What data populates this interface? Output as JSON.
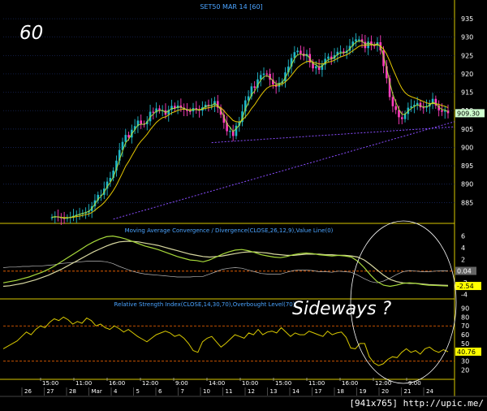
{
  "header": {
    "title": "SET50 MAR 14  [60]",
    "big_label": "60",
    "annotation": "Sideways ?",
    "footer_credit": "[941x765] http://upic.me/"
  },
  "colors": {
    "background": "#000000",
    "price_axis": "#ffffff",
    "title_text": "#4aa3ff",
    "up_candle": "#1fb8c8",
    "down_candle": "#ff3dbd",
    "ma_fast": "#a7d93a",
    "ma_slow": "#e6c800",
    "trendline": "#8a4dff",
    "macd_line": "#a7d93a",
    "macd_signal": "#d8d8a0",
    "macd_hist": "#b8b8b8",
    "rsi_line": "#d8c800",
    "overbought": "#ff6a00",
    "frame": "#d8c800",
    "circle": "#ffffff",
    "last_price_box": "#d0ffd0",
    "highlight_box": "#ffff00"
  },
  "chart_data": [
    {
      "type": "candlestick",
      "title": "SET50 MAR 14  [60]",
      "ylim": [
        880,
        937
      ],
      "yticks": [
        885,
        890,
        895,
        900,
        905,
        910,
        915,
        920,
        925,
        930,
        935
      ],
      "last_value_label": "909.30",
      "last_value": 909.3,
      "series_close": [
        881.0,
        881.2,
        881.0,
        880.8,
        880.6,
        880.9,
        881.1,
        881.4,
        881.7,
        881.9,
        882.2,
        882.3,
        882.7,
        884.0,
        885.6,
        887.1,
        887.1,
        888.8,
        890.7,
        891.7,
        893.7,
        896.4,
        899.3,
        901.5,
        903.4,
        902.7,
        904.8,
        905.8,
        907.3,
        906.4,
        906.3,
        907.1,
        909.7,
        909.5,
        910.6,
        910.1,
        910.1,
        908.9,
        910.2,
        911.3,
        910.7,
        911.4,
        910.8,
        910.4,
        909.9,
        909.8,
        910.7,
        910.3,
        910.0,
        910.9,
        911.6,
        911.4,
        911.5,
        912.6,
        910.8,
        908.9,
        906.7,
        904.4,
        904.5,
        903.1,
        905.9,
        906.9,
        909.8,
        912.8,
        913.9,
        916.6,
        916.2,
        918.5,
        919.7,
        920.1,
        920.0,
        918.4,
        917.1,
        916.5,
        917.5,
        917.9,
        920.4,
        922.0,
        924.3,
        925.9,
        926.3,
        925.5,
        924.8,
        925.4,
        923.1,
        921.5,
        922.1,
        921.1,
        922.5,
        924.1,
        924.7,
        924.1,
        925.1,
        926.0,
        926.1,
        925.7,
        926.3,
        927.6,
        928.8,
        929.4,
        929.4,
        928.7,
        927.0,
        928.8,
        927.8,
        927.7,
        928.6,
        926.4,
        922.1,
        918.8,
        913.7,
        911.2,
        910.2,
        908.2,
        907.7,
        909.1,
        910.8,
        911.2,
        911.6,
        912.1,
        910.9,
        910.8,
        911.1,
        911.8,
        913.2,
        911.4,
        910.1,
        909.7,
        910.0,
        909.3
      ],
      "series_ma_fast": [
        881.0,
        881.2,
        881.1,
        880.9,
        880.7,
        880.8,
        881.0,
        881.2,
        881.5,
        881.8,
        882.0,
        882.3,
        882.6,
        883.4,
        884.6,
        885.9,
        886.7,
        887.8,
        889.3,
        890.5,
        892.0,
        894.1,
        896.6,
        899.0,
        901.3,
        902.2,
        903.7,
        904.8,
        906.1,
        906.3,
        906.3,
        906.8,
        908.3,
        909.0,
        909.9,
        910.0,
        910.1,
        909.5,
        909.9,
        910.6,
        910.6,
        911.0,
        910.9,
        910.6,
        910.3,
        910.0,
        910.3,
        910.3,
        910.1,
        910.5,
        911.1,
        911.3,
        911.4,
        912.0,
        911.4,
        910.2,
        908.4,
        906.4,
        905.5,
        904.3,
        905.1,
        906.0,
        907.9,
        910.4,
        912.2,
        914.4,
        915.3,
        916.9,
        918.3,
        919.2,
        919.6,
        919.0,
        918.1,
        917.3,
        917.4,
        917.6,
        919.0,
        920.5,
        922.4,
        924.2,
        925.2,
        925.4,
        925.1,
        925.2,
        924.2,
        922.8,
        922.5,
        921.8,
        922.1,
        923.1,
        923.9,
        924.0,
        924.5,
        925.3,
        925.7,
        925.7,
        926.0,
        926.8,
        927.8,
        928.6,
        929.0,
        928.9,
        928.0,
        928.4,
        928.1,
        927.9,
        928.2,
        927.3,
        924.7,
        921.8,
        917.8,
        914.5,
        912.3,
        910.3,
        909.0,
        909.0,
        909.9,
        910.6,
        911.1,
        911.6,
        911.3,
        911.0,
        911.1,
        911.4,
        912.3,
        911.9,
        911.0,
        910.3,
        910.2,
        909.7
      ],
      "series_ma_slow": [
        881.0,
        881.1,
        881.1,
        881.0,
        880.9,
        880.9,
        880.9,
        881.0,
        881.2,
        881.3,
        881.5,
        881.7,
        881.9,
        882.3,
        882.9,
        883.6,
        884.2,
        885.0,
        886.0,
        887.1,
        888.3,
        889.7,
        891.4,
        893.1,
        894.9,
        896.2,
        897.7,
        899.1,
        900.6,
        901.7,
        902.6,
        903.6,
        904.8,
        905.8,
        906.8,
        907.5,
        908.1,
        908.3,
        908.8,
        909.4,
        909.7,
        910.1,
        910.3,
        910.4,
        910.3,
        910.2,
        910.3,
        910.3,
        910.3,
        910.4,
        910.6,
        910.8,
        910.9,
        911.3,
        911.2,
        910.8,
        910.0,
        909.0,
        908.2,
        907.3,
        907.0,
        906.9,
        907.4,
        908.3,
        909.3,
        910.6,
        911.6,
        912.9,
        914.1,
        915.2,
        916.1,
        916.6,
        916.8,
        916.8,
        917.0,
        917.2,
        917.8,
        918.6,
        919.6,
        920.7,
        921.7,
        922.4,
        922.9,
        923.4,
        923.4,
        923.2,
        923.0,
        922.7,
        922.7,
        922.9,
        923.2,
        923.4,
        923.7,
        924.2,
        924.6,
        924.9,
        925.2,
        925.7,
        926.3,
        926.9,
        927.5,
        927.8,
        927.7,
        927.9,
        927.9,
        927.8,
        927.9,
        927.6,
        926.7,
        925.4,
        923.5,
        921.4,
        919.5,
        917.6,
        916.0,
        914.9,
        914.2,
        913.8,
        913.5,
        913.2,
        912.8,
        912.5,
        912.1,
        911.9,
        912.0,
        911.9,
        911.7,
        911.4,
        911.2,
        910.8
      ]
    },
    {
      "type": "line",
      "title": "Moving Average Convergence / Divergence(CLOSE,26,12,9),Value Line(0)",
      "ylim": [
        -4.2,
        7.2
      ],
      "yticks": [
        -4,
        -2,
        0,
        2,
        4,
        6
      ],
      "value_line": 0,
      "last_value_labels": [
        "0.04",
        "-2.54"
      ],
      "series": [
        {
          "name": "MACD",
          "values": [
            -2.0,
            -1.8,
            -1.6,
            -1.3,
            -1.0,
            -0.6,
            -0.2,
            0.3,
            0.9,
            1.6,
            2.3,
            3.0,
            3.7,
            4.4,
            5.0,
            5.5,
            5.9,
            6.0,
            5.8,
            5.5,
            5.1,
            4.7,
            4.3,
            4.0,
            3.7,
            3.3,
            2.9,
            2.5,
            2.2,
            1.9,
            1.8,
            1.6,
            1.9,
            2.4,
            2.9,
            3.3,
            3.6,
            3.7,
            3.5,
            3.2,
            2.8,
            2.6,
            2.4,
            2.3,
            2.5,
            2.8,
            3.0,
            3.1,
            3.0,
            2.8,
            2.7,
            2.6,
            2.7,
            2.6,
            2.4,
            1.7,
            0.6,
            -0.7,
            -1.8,
            -2.4,
            -2.6,
            -2.4,
            -2.1,
            -2.0,
            -2.1,
            -2.3,
            -2.4,
            -2.45,
            -2.5,
            -2.54
          ]
        },
        {
          "name": "Signal",
          "values": [
            -2.6,
            -2.5,
            -2.3,
            -2.1,
            -1.8,
            -1.5,
            -1.1,
            -0.7,
            -0.2,
            0.3,
            0.9,
            1.5,
            2.1,
            2.7,
            3.3,
            3.8,
            4.3,
            4.7,
            5.0,
            5.1,
            5.1,
            5.0,
            4.8,
            4.6,
            4.4,
            4.1,
            3.8,
            3.5,
            3.2,
            2.9,
            2.7,
            2.5,
            2.4,
            2.5,
            2.6,
            2.8,
            3.0,
            3.2,
            3.3,
            3.3,
            3.2,
            3.1,
            2.9,
            2.8,
            2.7,
            2.7,
            2.8,
            2.9,
            2.9,
            2.9,
            2.8,
            2.8,
            2.7,
            2.7,
            2.6,
            2.4,
            1.9,
            1.1,
            0.2,
            -0.7,
            -1.4,
            -1.8,
            -2.0,
            -2.1,
            -2.1,
            -2.2,
            -2.3,
            -2.35,
            -2.4,
            -2.45
          ]
        },
        {
          "name": "Histogram",
          "values": [
            0.6,
            0.7,
            0.7,
            0.8,
            0.8,
            0.9,
            0.9,
            1.0,
            1.1,
            1.3,
            1.4,
            1.5,
            1.6,
            1.7,
            1.7,
            1.7,
            1.6,
            1.3,
            0.8,
            0.4,
            0.0,
            -0.3,
            -0.5,
            -0.6,
            -0.7,
            -0.8,
            -0.9,
            -1.0,
            -1.0,
            -1.0,
            -0.9,
            -0.9,
            -0.5,
            -0.1,
            0.3,
            0.5,
            0.6,
            0.5,
            0.2,
            -0.1,
            -0.4,
            -0.5,
            -0.5,
            -0.5,
            -0.2,
            0.1,
            0.2,
            0.2,
            0.1,
            -0.1,
            -0.1,
            -0.2,
            0.0,
            -0.1,
            -0.2,
            -0.7,
            -1.3,
            -1.8,
            -2.0,
            -1.7,
            -1.2,
            -0.6,
            -0.1,
            0.1,
            0.0,
            -0.1,
            -0.1,
            0.0,
            0.05,
            0.04
          ]
        }
      ]
    },
    {
      "type": "line",
      "title": "Relative Strength Index(CLOSE,14,30,70),Overbought Level(70)",
      "ylim": [
        14,
        96
      ],
      "yticks": [
        20,
        30,
        40,
        50,
        60,
        70,
        80,
        90
      ],
      "overbought": 70,
      "oversold": 30,
      "last_value_label": "40.76",
      "series": [
        {
          "name": "RSI",
          "values": [
            44,
            47,
            50,
            53,
            58,
            63,
            60,
            66,
            70,
            68,
            74,
            78,
            76,
            80,
            77,
            72,
            75,
            73,
            79,
            76,
            70,
            72,
            68,
            66,
            70,
            67,
            63,
            66,
            62,
            58,
            55,
            52,
            56,
            60,
            62,
            64,
            62,
            58,
            60,
            56,
            50,
            42,
            40,
            52,
            56,
            58,
            52,
            46,
            50,
            55,
            60,
            58,
            56,
            62,
            60,
            66,
            60,
            63,
            64,
            62,
            68,
            63,
            58,
            62,
            60,
            60,
            64,
            62,
            60,
            58,
            64,
            60,
            62,
            63,
            57,
            45,
            44,
            50,
            50,
            35,
            28,
            25,
            27,
            32,
            35,
            34,
            40,
            44,
            40,
            42,
            38,
            44,
            46,
            42,
            40,
            43,
            40.76
          ]
        }
      ]
    }
  ],
  "time_axis": {
    "hours": [
      "15:00",
      "11:00",
      "16:00",
      "12:00",
      "9:00",
      "14:00",
      "10:00",
      "15:00",
      "11:00",
      "16:00",
      "12:00",
      "9:00"
    ],
    "days": [
      "26",
      "27",
      "28",
      "Mar",
      "4",
      "5",
      "6",
      "7",
      "10",
      "11",
      "12",
      "13",
      "14",
      "17",
      "18",
      "19",
      "20",
      "21",
      "24"
    ]
  }
}
